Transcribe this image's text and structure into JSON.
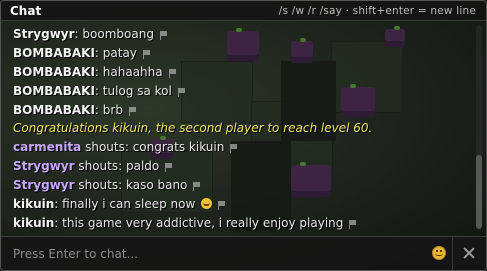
{
  "window": {
    "title": "Chat",
    "hint": "/s /w /r /say · shift+enter = new line"
  },
  "messages": [
    {
      "type": "chat",
      "name": "Strygwyr",
      "text": ": boomboang",
      "flag_icon": "flag-icon"
    },
    {
      "type": "chat",
      "name": "BOMBABAKI",
      "text": ": patay",
      "flag_icon": "flag-icon"
    },
    {
      "type": "chat",
      "name": "BOMBABAKI",
      "text": ": hahaahha",
      "flag_icon": "flag-icon"
    },
    {
      "type": "chat",
      "name": "BOMBABAKI",
      "text": ": tulog sa kol",
      "flag_icon": "flag-icon"
    },
    {
      "type": "chat",
      "name": "BOMBABAKI",
      "text": ": brb",
      "flag_icon": "flag-icon"
    },
    {
      "type": "system",
      "text": "Congratulations kikuin, the second player to reach level 60."
    },
    {
      "type": "shout",
      "name": "carmenita",
      "text": " shouts: congrats kikuin",
      "flag_icon": "flag-icon"
    },
    {
      "type": "shout",
      "name": "Strygwyr",
      "text": " shouts: paldo",
      "flag_icon": "flag-icon"
    },
    {
      "type": "shout",
      "name": "Strygwyr",
      "text": " shouts: kaso bano",
      "flag_icon": "flag-icon"
    },
    {
      "type": "chat",
      "name": "kikuin",
      "text": ": finally i can sleep now",
      "emoji": "laughing-emoji-icon",
      "flag_icon": "flag-icon"
    },
    {
      "type": "chat",
      "name": "kikuin",
      "text": ": this game very addictive, i really enjoy playing",
      "flag_icon": "flag-icon"
    }
  ],
  "input": {
    "placeholder": "Press Enter to chat...",
    "value": ""
  },
  "controls": {
    "emoji_button_icon": "smiley-icon",
    "close_button_icon": "close-icon"
  },
  "colors": {
    "shout_name": "#c9a7ff",
    "system_text": "#efe06c",
    "name_default": "#f4f4f4"
  }
}
